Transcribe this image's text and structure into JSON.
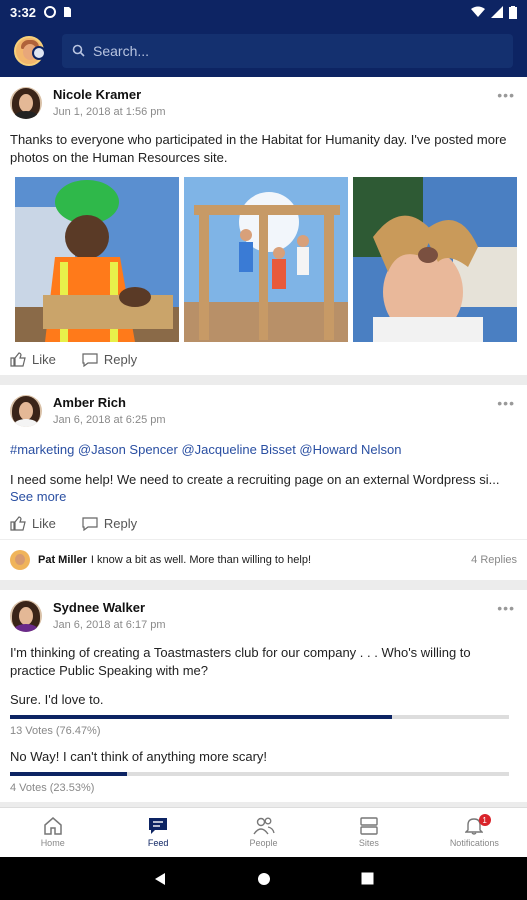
{
  "status_bar": {
    "time": "3:32"
  },
  "search": {
    "placeholder": "Search..."
  },
  "posts": [
    {
      "author": "Nicole Kramer",
      "date": "Jun 1, 2018 at 1:56 pm",
      "text": "Thanks to everyone who participated in the Habitat for Humanity day. I've posted more photos on the Human Resources site.",
      "like_label": "Like",
      "reply_label": "Reply"
    },
    {
      "author": "Amber Rich",
      "date": "Jan 6, 2018 at 6:25 pm",
      "tags": "#marketing @Jason Spencer @Jacqueline Bisset @Howard Nelson",
      "text": "I need some help! We need to create a recruiting page on an external Wordpress si...",
      "see_more": "See more",
      "like_label": "Like",
      "reply_label": "Reply",
      "reply_preview": {
        "name": "Pat Miller",
        "text": "I know a bit as well.  More than willing to help!",
        "count": "4 Replies"
      }
    },
    {
      "author": "Sydnee Walker",
      "date": "Jan 6, 2018 at 6:17 pm",
      "text": "I'm thinking of creating a Toastmasters club for our company . . . Who's willing to practice Public Speaking with me?",
      "poll": [
        {
          "option": "Sure. I'd love to.",
          "votes": "13 Votes (76.47%)",
          "fraction": 0.7647
        },
        {
          "option": "No Way! I can't think of anything more scary!",
          "votes": "4 Votes (23.53%)",
          "fraction": 0.2353
        }
      ]
    }
  ],
  "nav": {
    "items": [
      {
        "label": "Home",
        "icon": "home-icon"
      },
      {
        "label": "Feed",
        "icon": "feed-icon"
      },
      {
        "label": "People",
        "icon": "people-icon"
      },
      {
        "label": "Sites",
        "icon": "sites-icon"
      },
      {
        "label": "Notifications",
        "icon": "bell-icon"
      }
    ],
    "active": "Feed",
    "notification_count": "1"
  },
  "colors": {
    "brand": "#0d2463",
    "link": "#2a4fa2",
    "badge": "#d9232a"
  }
}
